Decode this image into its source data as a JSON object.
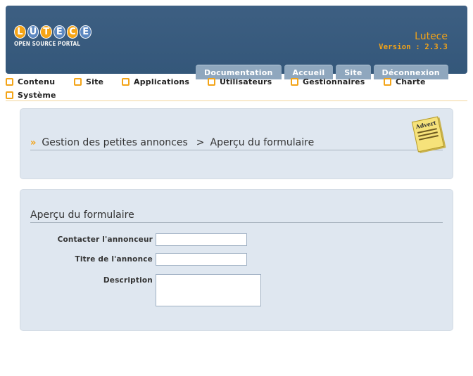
{
  "header": {
    "logo_letters": [
      "L",
      "U",
      "T",
      "E",
      "C",
      "E"
    ],
    "logo_subtitle": "OPEN SOURCE PORTAL",
    "site_name": "Lutece",
    "version": "Version : 2.3.3",
    "tabs": [
      "Documentation",
      "Accueil",
      "Site",
      "Déconnexion"
    ]
  },
  "menu": {
    "items": [
      "Contenu",
      "Site",
      "Applications",
      "Utilisateurs",
      "Gestionnaires",
      "Charte",
      "Système"
    ]
  },
  "page": {
    "breadcrumb_root": "Gestion des petites annonces",
    "breadcrumb_sep": ">",
    "breadcrumb_current": "Aperçu du formulaire",
    "advert_label": "Advert"
  },
  "form": {
    "title": "Aperçu du formulaire",
    "fields": [
      {
        "label": "Contacter l'annonceur",
        "value": ""
      },
      {
        "label": "Titre de l'annonce",
        "value": ""
      },
      {
        "label": "Description",
        "value": ""
      }
    ]
  },
  "colors": {
    "header_bg": "#3d5f82",
    "accent": "#f5a416",
    "tab_bg": "#8fa7be",
    "panel_bg": "#dfe7f0"
  }
}
